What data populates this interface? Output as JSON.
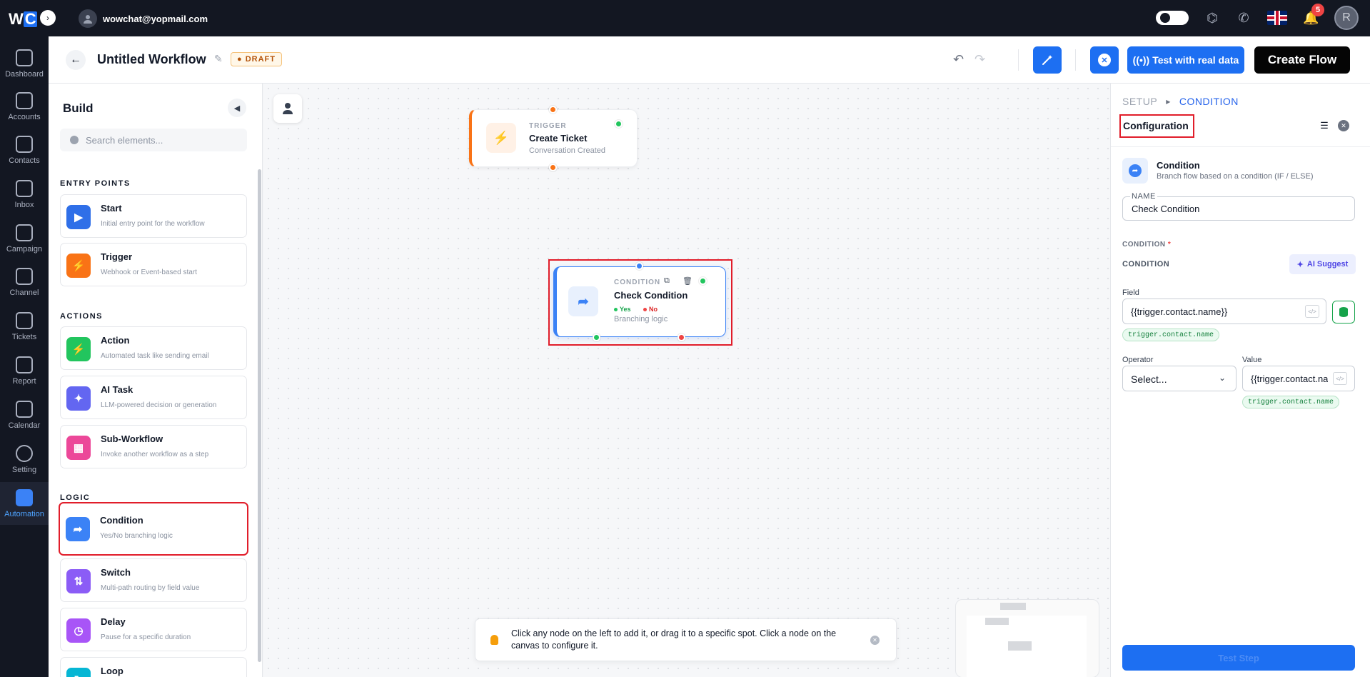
{
  "topbar": {
    "logo_w": "W",
    "logo_c": "C",
    "logo_toggle": "›",
    "user_email": "wowchat@yopmail.com",
    "notification_count": "5",
    "avatar_initial": "R"
  },
  "nav": {
    "items": [
      {
        "label": "Dashboard"
      },
      {
        "label": "Accounts"
      },
      {
        "label": "Contacts"
      },
      {
        "label": "Inbox"
      },
      {
        "label": "Campaign"
      },
      {
        "label": "Channel"
      },
      {
        "label": "Tickets"
      },
      {
        "label": "Report"
      },
      {
        "label": "Calendar"
      },
      {
        "label": "Setting"
      },
      {
        "label": "Automation",
        "active": true
      }
    ]
  },
  "header": {
    "title": "Untitled Workflow",
    "status": "DRAFT",
    "test_label": "Test with real data",
    "create_label": "Create Flow"
  },
  "build": {
    "title": "Build",
    "search_placeholder": "Search elements...",
    "sections": {
      "entry": "ENTRY POINTS",
      "actions": "ACTIONS",
      "logic": "LOGIC"
    },
    "elements": {
      "start": {
        "name": "Start",
        "desc": "Initial entry point for the workflow",
        "color": "#2f6fe8"
      },
      "trigger": {
        "name": "Trigger",
        "desc": "Webhook or Event-based start",
        "color": "#f97316"
      },
      "action": {
        "name": "Action",
        "desc": "Automated task like sending email",
        "color": "#22c55e"
      },
      "ai_task": {
        "name": "AI Task",
        "desc": "LLM-powered decision or generation",
        "color": "#6366f1"
      },
      "sub_workflow": {
        "name": "Sub-Workflow",
        "desc": "Invoke another workflow as a step",
        "color": "#ec4899"
      },
      "condition": {
        "name": "Condition",
        "desc": "Yes/No branching logic",
        "color": "#3b82f6"
      },
      "switch": {
        "name": "Switch",
        "desc": "Multi-path routing by field value",
        "color": "#8b5cf6"
      },
      "delay": {
        "name": "Delay",
        "desc": "Pause for a specific duration",
        "color": "#a855f7"
      },
      "loop": {
        "name": "Loop",
        "desc": "",
        "color": "#06b6d4"
      }
    }
  },
  "canvas": {
    "trigger_node": {
      "kicker": "TRIGGER",
      "title": "Create Ticket",
      "subtitle": "Conversation Created"
    },
    "condition_node": {
      "kicker": "CONDITION",
      "title": "Check Condition",
      "yes": "Yes",
      "no": "No",
      "subtitle": "Branching logic"
    },
    "hint": "Click any node on the left to add it, or drag it to a specific spot. Click a node on the canvas to configure it."
  },
  "config": {
    "crumb_setup": "SETUP",
    "crumb_current": "CONDITION",
    "title": "Configuration",
    "node_name": "Condition",
    "node_desc": "Branch flow based on a condition (IF / ELSE)",
    "name_label": "NAME",
    "name_value": "Check Condition",
    "condition_required": "CONDITION",
    "condition_heading": "CONDITION",
    "ai_suggest": "AI Suggest",
    "field_label": "Field",
    "field_value": "{{trigger.contact.name}}",
    "field_chip": "trigger.contact.name",
    "operator_label": "Operator",
    "operator_value": "Select...",
    "value_label": "Value",
    "value_value": "{{trigger.contact.name}}",
    "value_chip": "trigger.contact.name",
    "test_step": "Test Step"
  }
}
